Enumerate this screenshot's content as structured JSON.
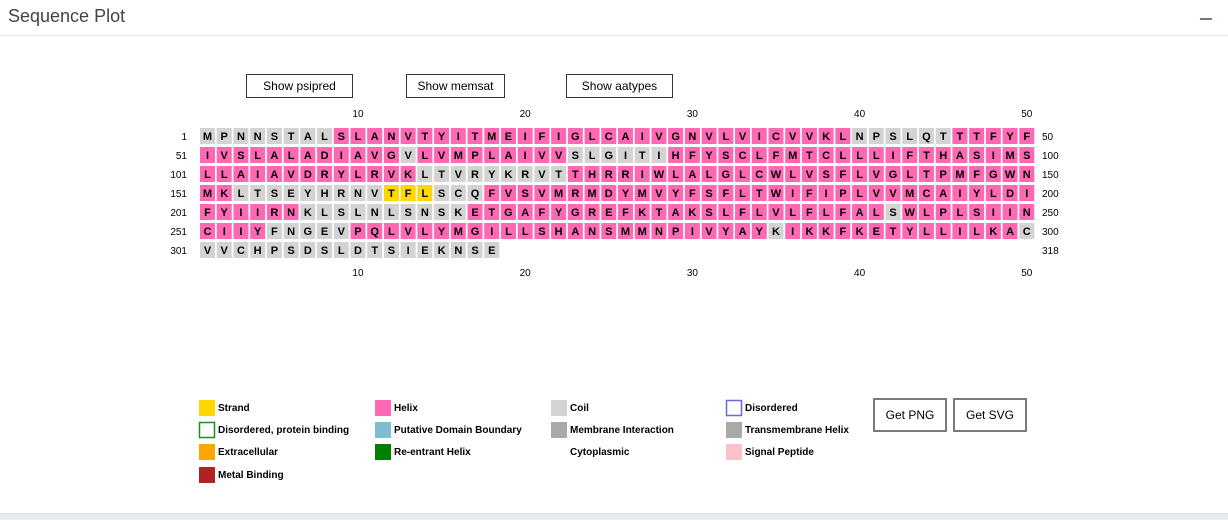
{
  "panel": {
    "title": "Sequence Plot",
    "collapse_icon": "minus-icon"
  },
  "buttons": {
    "show_psipred": "Show psipred",
    "show_memsat": "Show memsat",
    "show_aatypes": "Show aatypes",
    "get_png": "Get PNG",
    "get_svg": "Get SVG"
  },
  "ruler": [
    "10",
    "20",
    "30",
    "40",
    "50"
  ],
  "colors": {
    "helix": "#ff69b4",
    "coil": "#d3d3d3",
    "strand": "#ffd700",
    "disordered_border": "#6666ee",
    "disordered_binding_border": "#228b22",
    "putative_domain_boundary": "#7fbcd2",
    "membrane_interaction": "#a9a9a9",
    "transmembrane_helix": "#a9a9a9",
    "extracellular": "#ffa500",
    "reentrant_helix": "#008000",
    "signal_peptide": "#ffc0cb",
    "metal_binding": "#b22222"
  },
  "rows": [
    {
      "start": "1",
      "end": "50",
      "residues": "MPNNSTALSLANVTYITMEIFIGLCAIVGNVLVICVVKLNPSLQTTTFYF",
      "ss": "CCCCCCCCHHHHHHHHHHHHHHHHHHHHHHHHHHHHHHHCCCCCCHHHHH"
    },
    {
      "start": "51",
      "end": "100",
      "residues": "IVSLALADIAVGVLVMPLAIVVSLGITIHFYSCLFMTCLLLIFTHASIMS",
      "ss": "HHHHHHHHHHHHCHHHHHHHHHCCCCCCHHHHHHHHHHHHHHHHHHHHHH"
    },
    {
      "start": "101",
      "end": "150",
      "residues": "LLAIAVDRYLRVKLTVRYKRVTTHRRIWLALGLCWLVSFLVGLTPMFGWN",
      "ss": "HHHHHHHHHHHHHCCCCCCCCCHHHHHHHHHHHHHHHHHHHHHHHHHHHH"
    },
    {
      "start": "151",
      "end": "200",
      "residues": "MKLTSEYHRNVTFLSCQFVSVMRMDYMVYFSFLTWIFIPLVVMCAIYLDI",
      "ss": "HHCCCCCCCCCEEECCCHHHHHHHHHHHHHHHHHHHHHHHHHHHHHHHHH"
    },
    {
      "start": "201",
      "end": "250",
      "residues": "FYIIRNKLSLNLSNSKETGAFYGREFKTAKSLFLVLFLFALSWLPLSIIN",
      "ss": "HHHHHHCCCCCCCCCCHHHHHHHHHHHHHHHHHHHHHHHHHCHHHHHHHH"
    },
    {
      "start": "251",
      "end": "300",
      "residues": "CIIYFNGEVPQLVLYMGILLSHANSMMNPIVYAYKIKKFKETYLLILKAC",
      "ss": "HHHHCCCCCHHHHHHHHHHHHHHHHHHHHHHHHHCHHHHHHHHHHHHHHC"
    },
    {
      "start": "301",
      "end": "318",
      "residues": "VVCHPSDSLDTSIEKNSE",
      "ss": "CCCCCCCCCCCCCCCCCC"
    }
  ],
  "legend": [
    {
      "label": "Strand",
      "swatch": "strand"
    },
    {
      "label": "Helix",
      "swatch": "helix"
    },
    {
      "label": "Coil",
      "swatch": "coil"
    },
    {
      "label": "Disordered",
      "swatch": "disordered"
    },
    {
      "label": "Disordered, protein binding",
      "swatch": "disordered_binding"
    },
    {
      "label": "Putative Domain Boundary",
      "swatch": "putative_domain_boundary"
    },
    {
      "label": "Membrane Interaction",
      "swatch": "membrane_interaction"
    },
    {
      "label": "Transmembrane Helix",
      "swatch": "transmembrane_helix"
    },
    {
      "label": "Extracellular",
      "swatch": "extracellular"
    },
    {
      "label": "Re-entrant Helix",
      "swatch": "reentrant_helix"
    },
    {
      "label": "Cytoplasmic",
      "swatch": "none"
    },
    {
      "label": "Signal Peptide",
      "swatch": "signal_peptide"
    },
    {
      "label": "Metal Binding",
      "swatch": "metal_binding"
    }
  ]
}
